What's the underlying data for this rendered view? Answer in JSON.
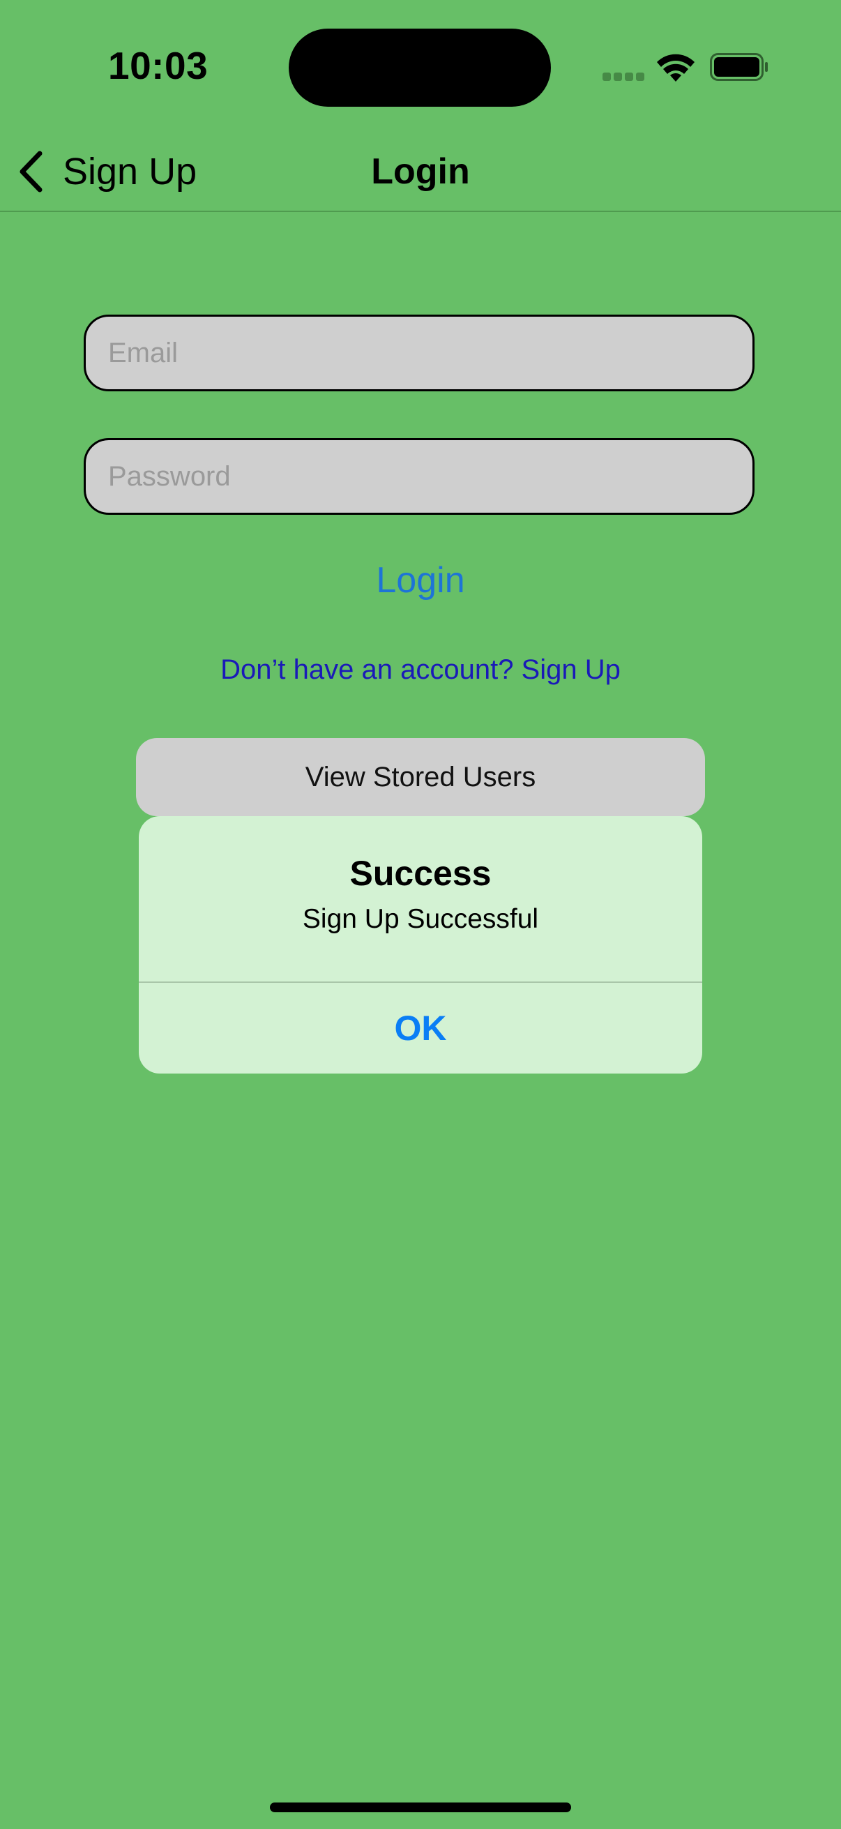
{
  "status_bar": {
    "time": "10:03",
    "icons": [
      "cellular-signal-icon",
      "wifi-icon",
      "battery-icon"
    ]
  },
  "nav": {
    "back_label": "Sign Up",
    "back_icon": "chevron-left-icon",
    "title": "Login"
  },
  "form": {
    "email": {
      "placeholder": "Email",
      "value": ""
    },
    "password": {
      "placeholder": "Password",
      "value": ""
    },
    "login_label": "Login",
    "signup_link": "Don’t have an account? Sign Up",
    "stored_users_label": "View Stored Users"
  },
  "alert": {
    "title": "Success",
    "message": "Sign Up Successful",
    "ok_label": "OK"
  },
  "colors": {
    "background": "#67bf67",
    "link_blue": "#1d74d7",
    "signup_link": "#1a1ab8",
    "alert_background": "#d3f2d3",
    "alert_button": "#0a7ef5",
    "field_background": "#cfcfcf"
  }
}
